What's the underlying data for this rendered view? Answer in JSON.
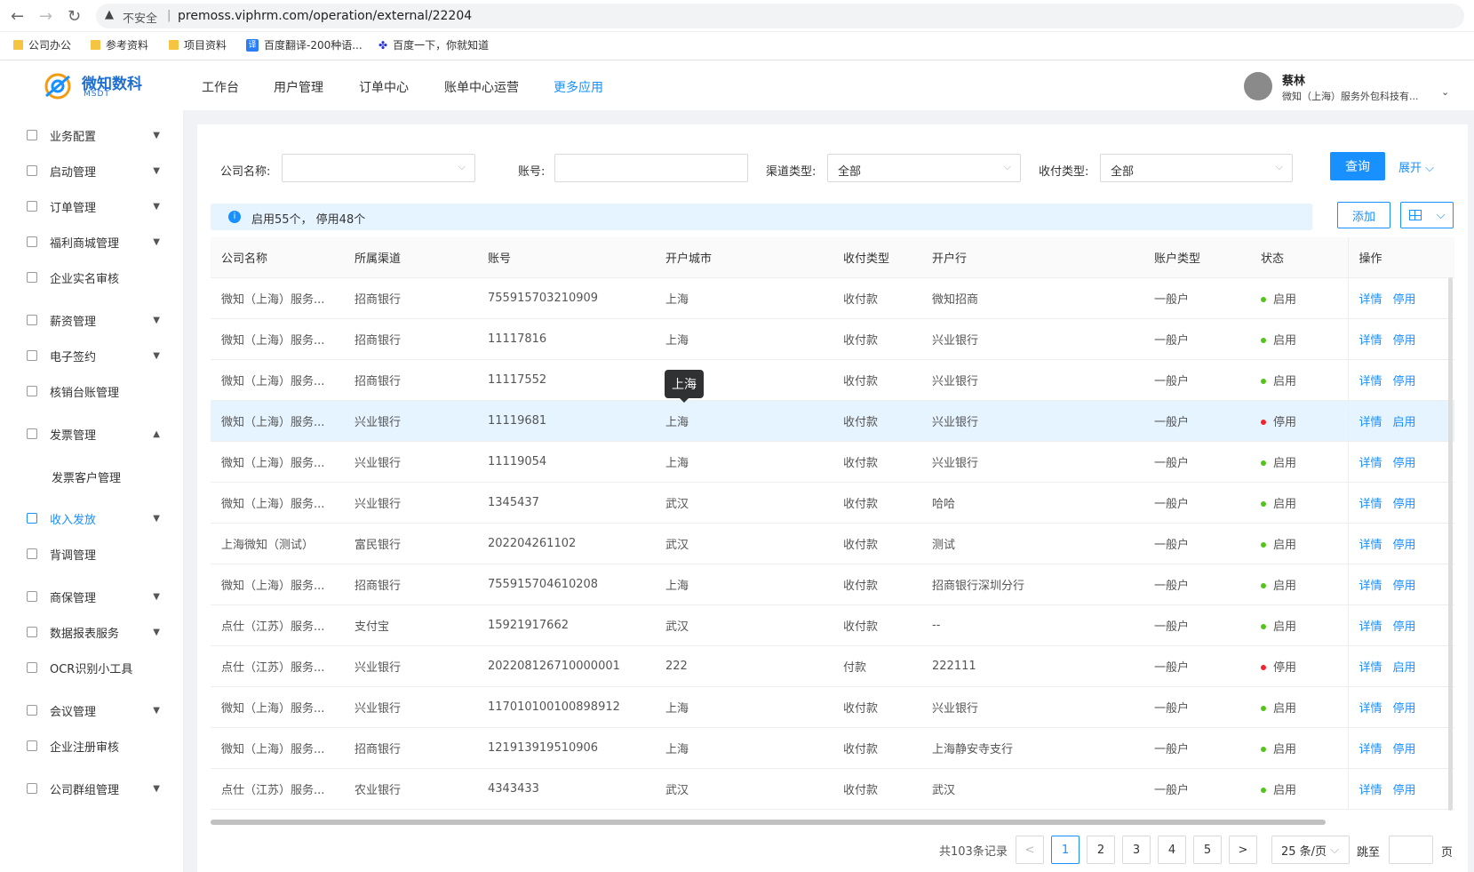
{
  "browser": {
    "back": "←",
    "forward": "→",
    "reload": "↻",
    "security": "不安全",
    "url": "premoss.viphrm.com/operation/external/22204"
  },
  "bookmarks": [
    "公司办公",
    "参考资料",
    "项目资料",
    "百度翻译-200种语...",
    "百度一下，你就知道"
  ],
  "brand": {
    "name": "微知数科",
    "sub": "MSDT"
  },
  "topnav": [
    "工作台",
    "用户管理",
    "订单中心",
    "账单中心运营",
    "更多应用"
  ],
  "user": {
    "name": "蔡林",
    "company": "微知（上海）服务外包科技有..."
  },
  "sidebar": [
    "业务配置",
    "启动管理",
    "订单管理",
    "福利商城管理",
    "企业实名审核",
    "薪资管理",
    "电子签约",
    "核销台账管理",
    "发票管理",
    "发票客户管理",
    "收入发放",
    "背调管理",
    "商保管理",
    "数据报表服务",
    "OCR识别小工具",
    "会议管理",
    "企业注册审核",
    "公司群组管理"
  ],
  "filters": {
    "company_label": "公司名称:",
    "account_label": "账号:",
    "channel_label": "渠道类型:",
    "channel_value": "全部",
    "paytype_label": "收付类型:",
    "paytype_value": "全部",
    "query": "查询",
    "expand": "展开"
  },
  "alert": "启用55个， 停用48个",
  "actions": {
    "add": "添加"
  },
  "columns": [
    "公司名称",
    "所属渠道",
    "账号",
    "开户城市",
    "收付类型",
    "开户行",
    "账户类型",
    "状态",
    "操作"
  ],
  "rows": [
    [
      "微知（上海）服务...",
      "招商银行",
      "755915703210909",
      "上海",
      "收付款",
      "微知招商",
      "一般户",
      "启用",
      "详情",
      "停用"
    ],
    [
      "微知（上海）服务...",
      "招商银行",
      "11117816",
      "上海",
      "收付款",
      "兴业银行",
      "一般户",
      "启用",
      "详情",
      "停用"
    ],
    [
      "微知（上海）服务...",
      "招商银行",
      "11117552",
      "上海",
      "收付款",
      "兴业银行",
      "一般户",
      "启用",
      "详情",
      "停用"
    ],
    [
      "微知（上海）服务...",
      "兴业银行",
      "11119681",
      "上海",
      "收付款",
      "兴业银行",
      "一般户",
      "停用",
      "详情",
      "启用"
    ],
    [
      "微知（上海）服务...",
      "兴业银行",
      "11119054",
      "上海",
      "收付款",
      "兴业银行",
      "一般户",
      "启用",
      "详情",
      "停用"
    ],
    [
      "微知（上海）服务...",
      "兴业银行",
      "1345437",
      "武汉",
      "收付款",
      "哈哈",
      "一般户",
      "启用",
      "详情",
      "停用"
    ],
    [
      "上海微知（测试）",
      "富民银行",
      "202204261102",
      "武汉",
      "收付款",
      "测试",
      "一般户",
      "启用",
      "详情",
      "停用"
    ],
    [
      "微知（上海）服务...",
      "招商银行",
      "755915704610208",
      "上海",
      "收付款",
      "招商银行深圳分行",
      "一般户",
      "启用",
      "详情",
      "停用"
    ],
    [
      "点仕（江苏）服务...",
      "支付宝",
      "15921917662",
      "武汉",
      "收付款",
      "--",
      "一般户",
      "启用",
      "详情",
      "停用"
    ],
    [
      "点仕（江苏）服务...",
      "兴业银行",
      "202208126710000001",
      "222",
      "付款",
      "222111",
      "一般户",
      "停用",
      "详情",
      "启用"
    ],
    [
      "微知（上海）服务...",
      "兴业银行",
      "117010100100898912",
      "上海",
      "收付款",
      "兴业银行",
      "一般户",
      "启用",
      "详情",
      "停用"
    ],
    [
      "微知（上海）服务...",
      "招商银行",
      "121913919510906",
      "上海",
      "收付款",
      "上海静安寺支行",
      "一般户",
      "启用",
      "详情",
      "停用"
    ],
    [
      "点仕（江苏）服务...",
      "农业银行",
      "4343433",
      "武汉",
      "收付款",
      "武汉",
      "一般户",
      "启用",
      "详情",
      "停用"
    ]
  ],
  "tooltip": "上海",
  "pagination": {
    "total": "共103条记录",
    "prev": "<",
    "pages": [
      "1",
      "2",
      "3",
      "4",
      "5"
    ],
    "next": ">",
    "size": "25 条/页",
    "jump": "跳至",
    "unit": "页"
  },
  "colors": {
    "primary": "#1890ff",
    "enabled": "#52c41a",
    "disabled": "#f5222d"
  }
}
